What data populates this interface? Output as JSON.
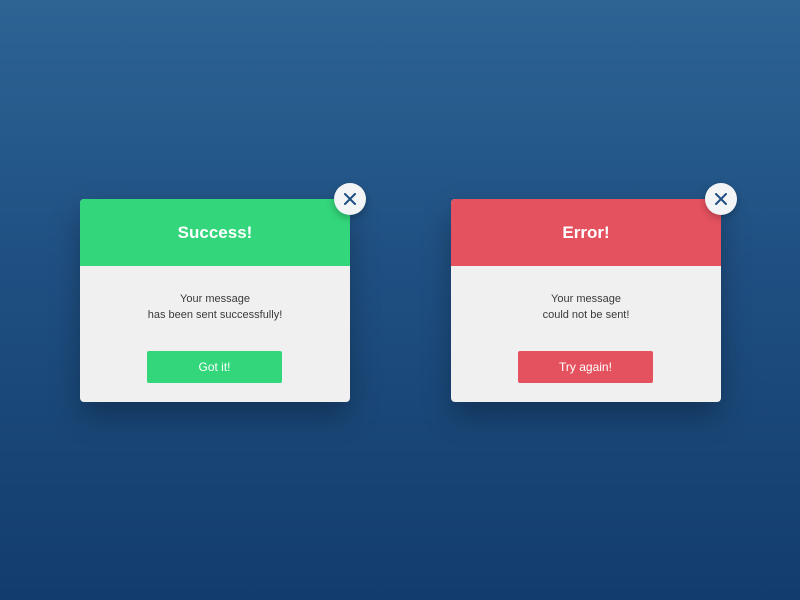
{
  "colors": {
    "background_top": "#2c6494",
    "background_bottom": "#123c6b",
    "success": "#33d67b",
    "error": "#e5525f",
    "dialog_body": "#f0f0f0",
    "close_icon": "#1f4f82"
  },
  "success_dialog": {
    "title": "Success!",
    "message_line1": "Your message",
    "message_line2": "has been sent successfully!",
    "button_label": "Got it!",
    "close_icon": "close-icon"
  },
  "error_dialog": {
    "title": "Error!",
    "message_line1": "Your message",
    "message_line2": "could not be sent!",
    "button_label": "Try again!",
    "close_icon": "close-icon"
  }
}
